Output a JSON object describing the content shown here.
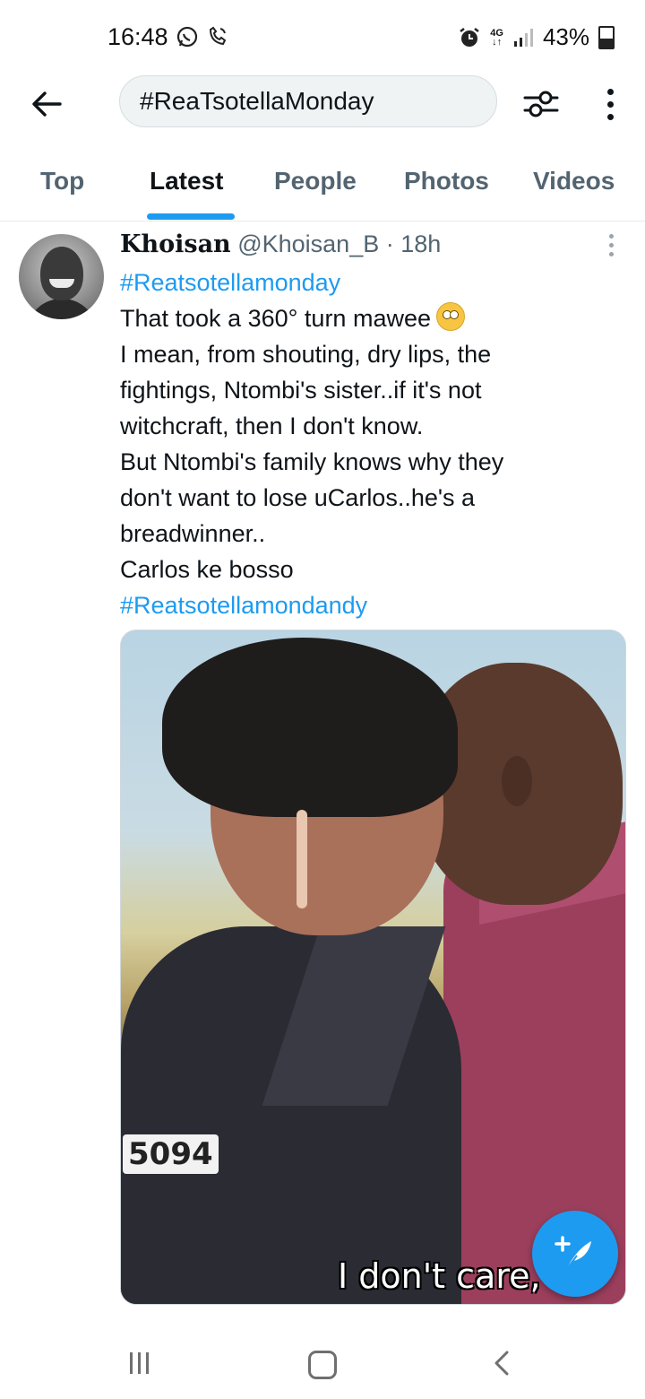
{
  "status_bar": {
    "time": "16:48",
    "network": "4G",
    "battery": "43%"
  },
  "search": {
    "query": "#ReaTsotellaMonday"
  },
  "tabs": [
    {
      "label": "Top"
    },
    {
      "label": "Latest"
    },
    {
      "label": "People"
    },
    {
      "label": "Photos"
    },
    {
      "label": "Videos"
    }
  ],
  "active_tab": "Latest",
  "tweet": {
    "display_name": "Khoisan",
    "handle": "@Khoisan_B",
    "separator": "·",
    "time_ago": "18h",
    "hashtag_top": "#Reatsotellamonday",
    "lines": [
      "That took a 360° turn mawee",
      "I mean, from shouting, dry lips, the",
      "fightings, Ntombi's sister..if it's not",
      "witchcraft, then I don't know.",
      "But Ntombi's family knows why they",
      "don't want to lose uCarlos..he's a",
      "breadwinner..",
      "Carlos ke bosso"
    ],
    "hashtag_bottom": "#Reatsotellamondandy",
    "media": {
      "counter_text": "5094",
      "subtitle_text": "I don't care, I"
    }
  },
  "colors": {
    "accent": "#1d9bf0",
    "text_primary": "#0f1419",
    "text_secondary": "#536471"
  },
  "icons": {
    "back": "back-arrow-icon",
    "filter": "filter-sliders-icon",
    "more": "more-vertical-icon",
    "compose": "compose-feather-icon"
  }
}
